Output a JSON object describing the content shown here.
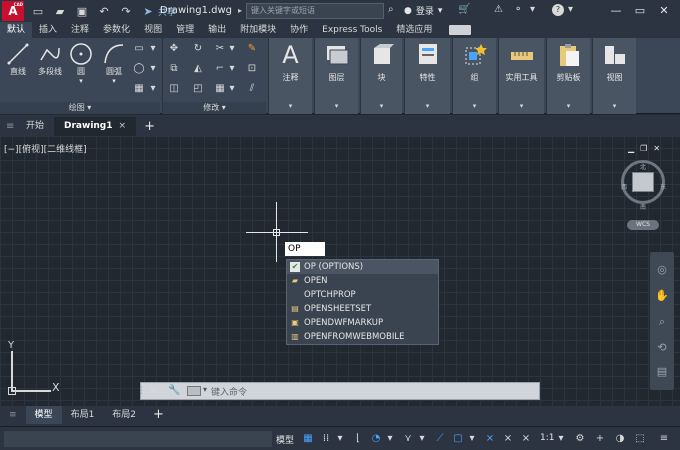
{
  "titlebar": {
    "logo_text": "A",
    "logo_sub": "CAD",
    "share_label": "共享",
    "doc_title": "Drawing1.dwg",
    "search_placeholder": "键入关键字或短语",
    "login_label": "登录",
    "help_label": "?"
  },
  "ribbon_tabs": [
    "默认",
    "插入",
    "注释",
    "参数化",
    "视图",
    "管理",
    "输出",
    "附加模块",
    "协作",
    "Express Tools",
    "精选应用"
  ],
  "ribbon": {
    "draw_tools": [
      "直线",
      "多段线",
      "圆",
      "圆弧"
    ],
    "draw_group_label": "绘图",
    "modify_group_label": "修改",
    "panels": [
      "注释",
      "图层",
      "块",
      "特性",
      "组",
      "实用工具",
      "剪贴板",
      "视图"
    ]
  },
  "file_tabs": {
    "start_label": "开始",
    "drawing_label": "Drawing1",
    "close_glyph": "×",
    "add_glyph": "+"
  },
  "canvas": {
    "view_label": "[−][俯视][二维线框]",
    "command_input_value": "OP",
    "autocomplete": [
      "OP (OPTIONS)",
      "OPEN",
      "OPTCHPROP",
      "OPENSHEETSET",
      "OPENDWFMARKUP",
      "OPENFROMWEBMOBILE"
    ],
    "ucs_x": "X",
    "ucs_y": "Y",
    "compass": {
      "north": "北",
      "south": "南",
      "east": "东",
      "west": "西"
    },
    "wcs_label": "WCS"
  },
  "command_line": {
    "placeholder": "键入命令"
  },
  "layout_tabs": [
    "模型",
    "布局1",
    "布局2"
  ],
  "layout_add": "+",
  "statusbar": {
    "model_label": "模型",
    "scale_label": "1:1"
  },
  "colors": {
    "accent": "#4aa3ff",
    "logo_red": "#c8102e",
    "background": "#212830"
  }
}
